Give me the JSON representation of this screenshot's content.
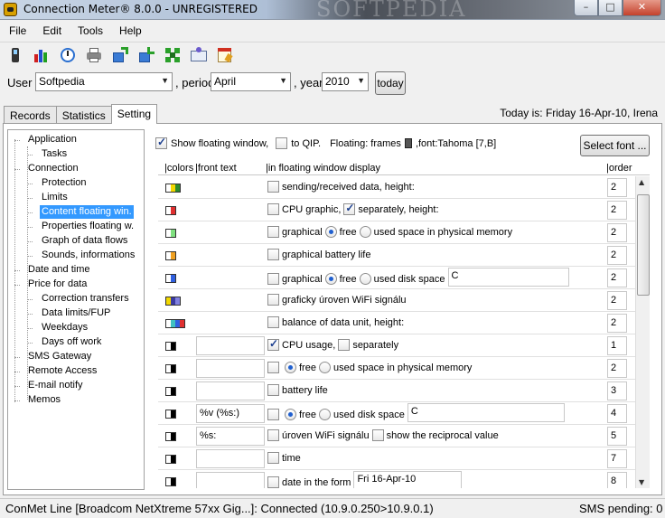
{
  "window": {
    "title": "Connection Meter® 8.0.0 - UNREGISTERED",
    "watermark": "SOFTPEDIA",
    "buttons": {
      "min": "–",
      "max": "□",
      "close": "✕"
    }
  },
  "menu": [
    "File",
    "Edit",
    "Tools",
    "Help"
  ],
  "toolbar": [
    "phone-icon",
    "bar-chart-icon",
    "clock-icon",
    "printer-icon",
    "export-icon",
    "import-icon",
    "network-icon",
    "mail-icon",
    "calendar-icon"
  ],
  "user_row": {
    "user_label": "User",
    "user_value": "Softpedia",
    "period_label": ", period",
    "period_value": "April",
    "year_label": ", year",
    "year_value": "2010",
    "today_button": "today"
  },
  "tabs": [
    "Records",
    "Statistics",
    "Setting"
  ],
  "active_tab": "Setting",
  "today_text": "Today is: Friday 16-Apr-10, Irena",
  "tree": [
    {
      "label": "Application",
      "level": 0
    },
    {
      "label": "Tasks",
      "level": 1
    },
    {
      "label": "Connection",
      "level": 0
    },
    {
      "label": "Protection",
      "level": 1
    },
    {
      "label": "Limits",
      "level": 1
    },
    {
      "label": "Content floating win.",
      "level": 1,
      "selected": true
    },
    {
      "label": "Properties floating w.",
      "level": 1
    },
    {
      "label": "Graph of data flows",
      "level": 1
    },
    {
      "label": "Sounds, informations",
      "level": 1
    },
    {
      "label": "Date and time",
      "level": 0
    },
    {
      "label": "Price for data",
      "level": 0
    },
    {
      "label": "Correction transfers",
      "level": 1
    },
    {
      "label": "Data limits/FUP",
      "level": 1
    },
    {
      "label": "Weekdays",
      "level": 1
    },
    {
      "label": "Days off work",
      "level": 1
    },
    {
      "label": "SMS Gateway",
      "level": 0
    },
    {
      "label": "Remote Access",
      "level": 0
    },
    {
      "label": "E-mail notify",
      "level": 0
    },
    {
      "label": "Memos",
      "level": 0
    }
  ],
  "options": {
    "show_floating": "Show  floating window,",
    "to_qip": "to QIP.",
    "floating_prefix": "Floating: frames",
    "floating_font": ",font:Tahoma [7,B]",
    "select_font": "Select font ..."
  },
  "grid": {
    "headers": [
      "|colors",
      "|front text",
      "|in floating window display",
      "|order"
    ],
    "rows": [
      {
        "colors": [
          "#ffffff",
          "#f2d800",
          "#2b8a2b"
        ],
        "front": null,
        "parts": [
          {
            "c": false
          },
          {
            "t": "sending/received data, height:"
          }
        ],
        "order": "2"
      },
      {
        "colors": [
          "#ffffff",
          "#e03030"
        ],
        "front": null,
        "parts": [
          {
            "c": false
          },
          {
            "t": "CPU graphic,"
          },
          {
            "c": true
          },
          {
            "t": "separately, height:"
          }
        ],
        "order": "2"
      },
      {
        "colors": [
          "#ffffff",
          "#7fe07f"
        ],
        "front": null,
        "parts": [
          {
            "c": false
          },
          {
            "t": "graphical"
          },
          {
            "r": true
          },
          {
            "t": "free"
          },
          {
            "r": false
          },
          {
            "t": "used space in physical memory"
          }
        ],
        "order": "2"
      },
      {
        "colors": [
          "#ffffff",
          "#f0a020"
        ],
        "front": null,
        "parts": [
          {
            "c": false
          },
          {
            "t": "graphical battery life"
          }
        ],
        "order": "2"
      },
      {
        "colors": [
          "#ffffff",
          "#3060e0"
        ],
        "front": null,
        "parts": [
          {
            "c": false
          },
          {
            "t": "graphical"
          },
          {
            "r": true
          },
          {
            "t": "free"
          },
          {
            "r": false
          },
          {
            "t": "used disk space"
          },
          {
            "box": "C",
            "w": 134
          }
        ],
        "order": "2"
      },
      {
        "colors": [
          "#f2d800",
          "#3a3aa0",
          "#8080e0"
        ],
        "front": null,
        "parts": [
          {
            "c": false
          },
          {
            "t": "graficky úroven WiFi signálu"
          }
        ],
        "order": "2"
      },
      {
        "colors": [
          "#ffffff",
          "#40c0c0",
          "#3060e0",
          "#e03030"
        ],
        "front": null,
        "parts": [
          {
            "c": false
          },
          {
            "t": "balance of data unit, height:"
          }
        ],
        "order": "2"
      },
      {
        "colors": [
          "#ffffff",
          "#000000"
        ],
        "front": "",
        "parts": [
          {
            "c": true
          },
          {
            "t": "CPU usage,"
          },
          {
            "c": false
          },
          {
            "t": "separately"
          }
        ],
        "order": "1"
      },
      {
        "colors": [
          "#ffffff",
          "#000000"
        ],
        "front": "",
        "parts": [
          {
            "c": false
          },
          {
            "t": " "
          },
          {
            "r": true
          },
          {
            "t": "free"
          },
          {
            "r": false
          },
          {
            "t": "used space in physical memory"
          }
        ],
        "order": "2"
      },
      {
        "colors": [
          "#ffffff",
          "#000000"
        ],
        "front": "",
        "parts": [
          {
            "c": false
          },
          {
            "t": "battery life"
          }
        ],
        "order": "3"
      },
      {
        "colors": [
          "#ffffff",
          "#000000"
        ],
        "front": "%v (%s:)",
        "parts": [
          {
            "c": false
          },
          {
            "t": " "
          },
          {
            "r": true
          },
          {
            "t": "free"
          },
          {
            "r": false
          },
          {
            "t": "used disk space"
          },
          {
            "box": "C",
            "w": 174
          }
        ],
        "order": "4"
      },
      {
        "colors": [
          "#ffffff",
          "#000000"
        ],
        "front": "%s:",
        "parts": [
          {
            "c": false
          },
          {
            "t": "úroven WiFi signálu"
          },
          {
            "c": false
          },
          {
            "t": "show the reciprocal value"
          }
        ],
        "order": "5"
      },
      {
        "colors": [
          "#ffffff",
          "#000000"
        ],
        "front": "",
        "parts": [
          {
            "c": false
          },
          {
            "t": "time"
          }
        ],
        "order": "7"
      },
      {
        "colors": [
          "#ffffff",
          "#000000"
        ],
        "front": "",
        "parts": [
          {
            "c": false
          },
          {
            "t": "date in the form"
          },
          {
            "box": "Fri 16-Apr-10",
            "w": 120
          }
        ],
        "order": "8"
      }
    ]
  },
  "statusbar": {
    "left": "ConMet Line [Broadcom NetXtreme 57xx Gig...]: Connected (10.9.0.250>10.9.0.1)",
    "right": "SMS pending: 0"
  }
}
